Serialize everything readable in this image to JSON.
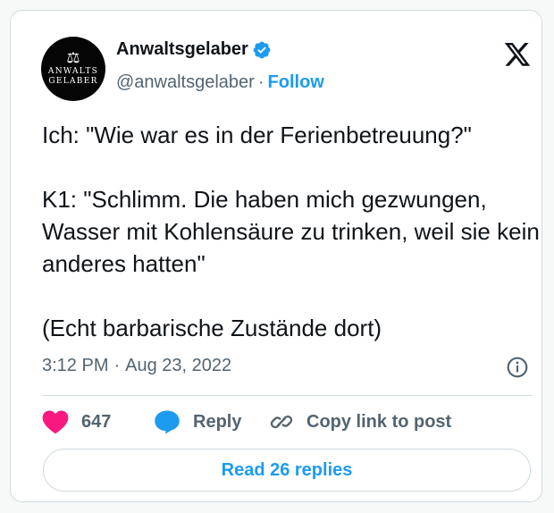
{
  "author": {
    "avatar_line1": "ANWALTS",
    "avatar_line2": "GELABER",
    "display_name": "Anwaltsgelaber",
    "handle": "@anwaltsgelaber",
    "separator": "·",
    "follow_label": "Follow",
    "verified": true
  },
  "tweet": {
    "paragraphs": [
      "Ich: \"Wie war es in der Ferienbetreuung?\"",
      "K1: \"Schlimm. Die haben mich gezwungen, Wasser mit Kohlensäure zu trinken, weil sie kein anderes hatten\"",
      "(Echt barbarische Zustände dort)"
    ],
    "time": "3:12 PM",
    "time_separator": "·",
    "date": "Aug 23, 2022"
  },
  "actions": {
    "like_count": "647",
    "reply_label": "Reply",
    "copy_label": "Copy link to post"
  },
  "read_replies_label": "Read 26 replies",
  "colors": {
    "accent": "#1d9bf0",
    "like": "#f91880",
    "text": "#0f1419",
    "muted": "#536471",
    "border": "#cfd9de"
  },
  "icons": [
    "avatar-scale-icon",
    "verified-badge-icon",
    "x-logo-icon",
    "info-icon",
    "heart-icon",
    "reply-bubble-icon",
    "link-icon"
  ]
}
